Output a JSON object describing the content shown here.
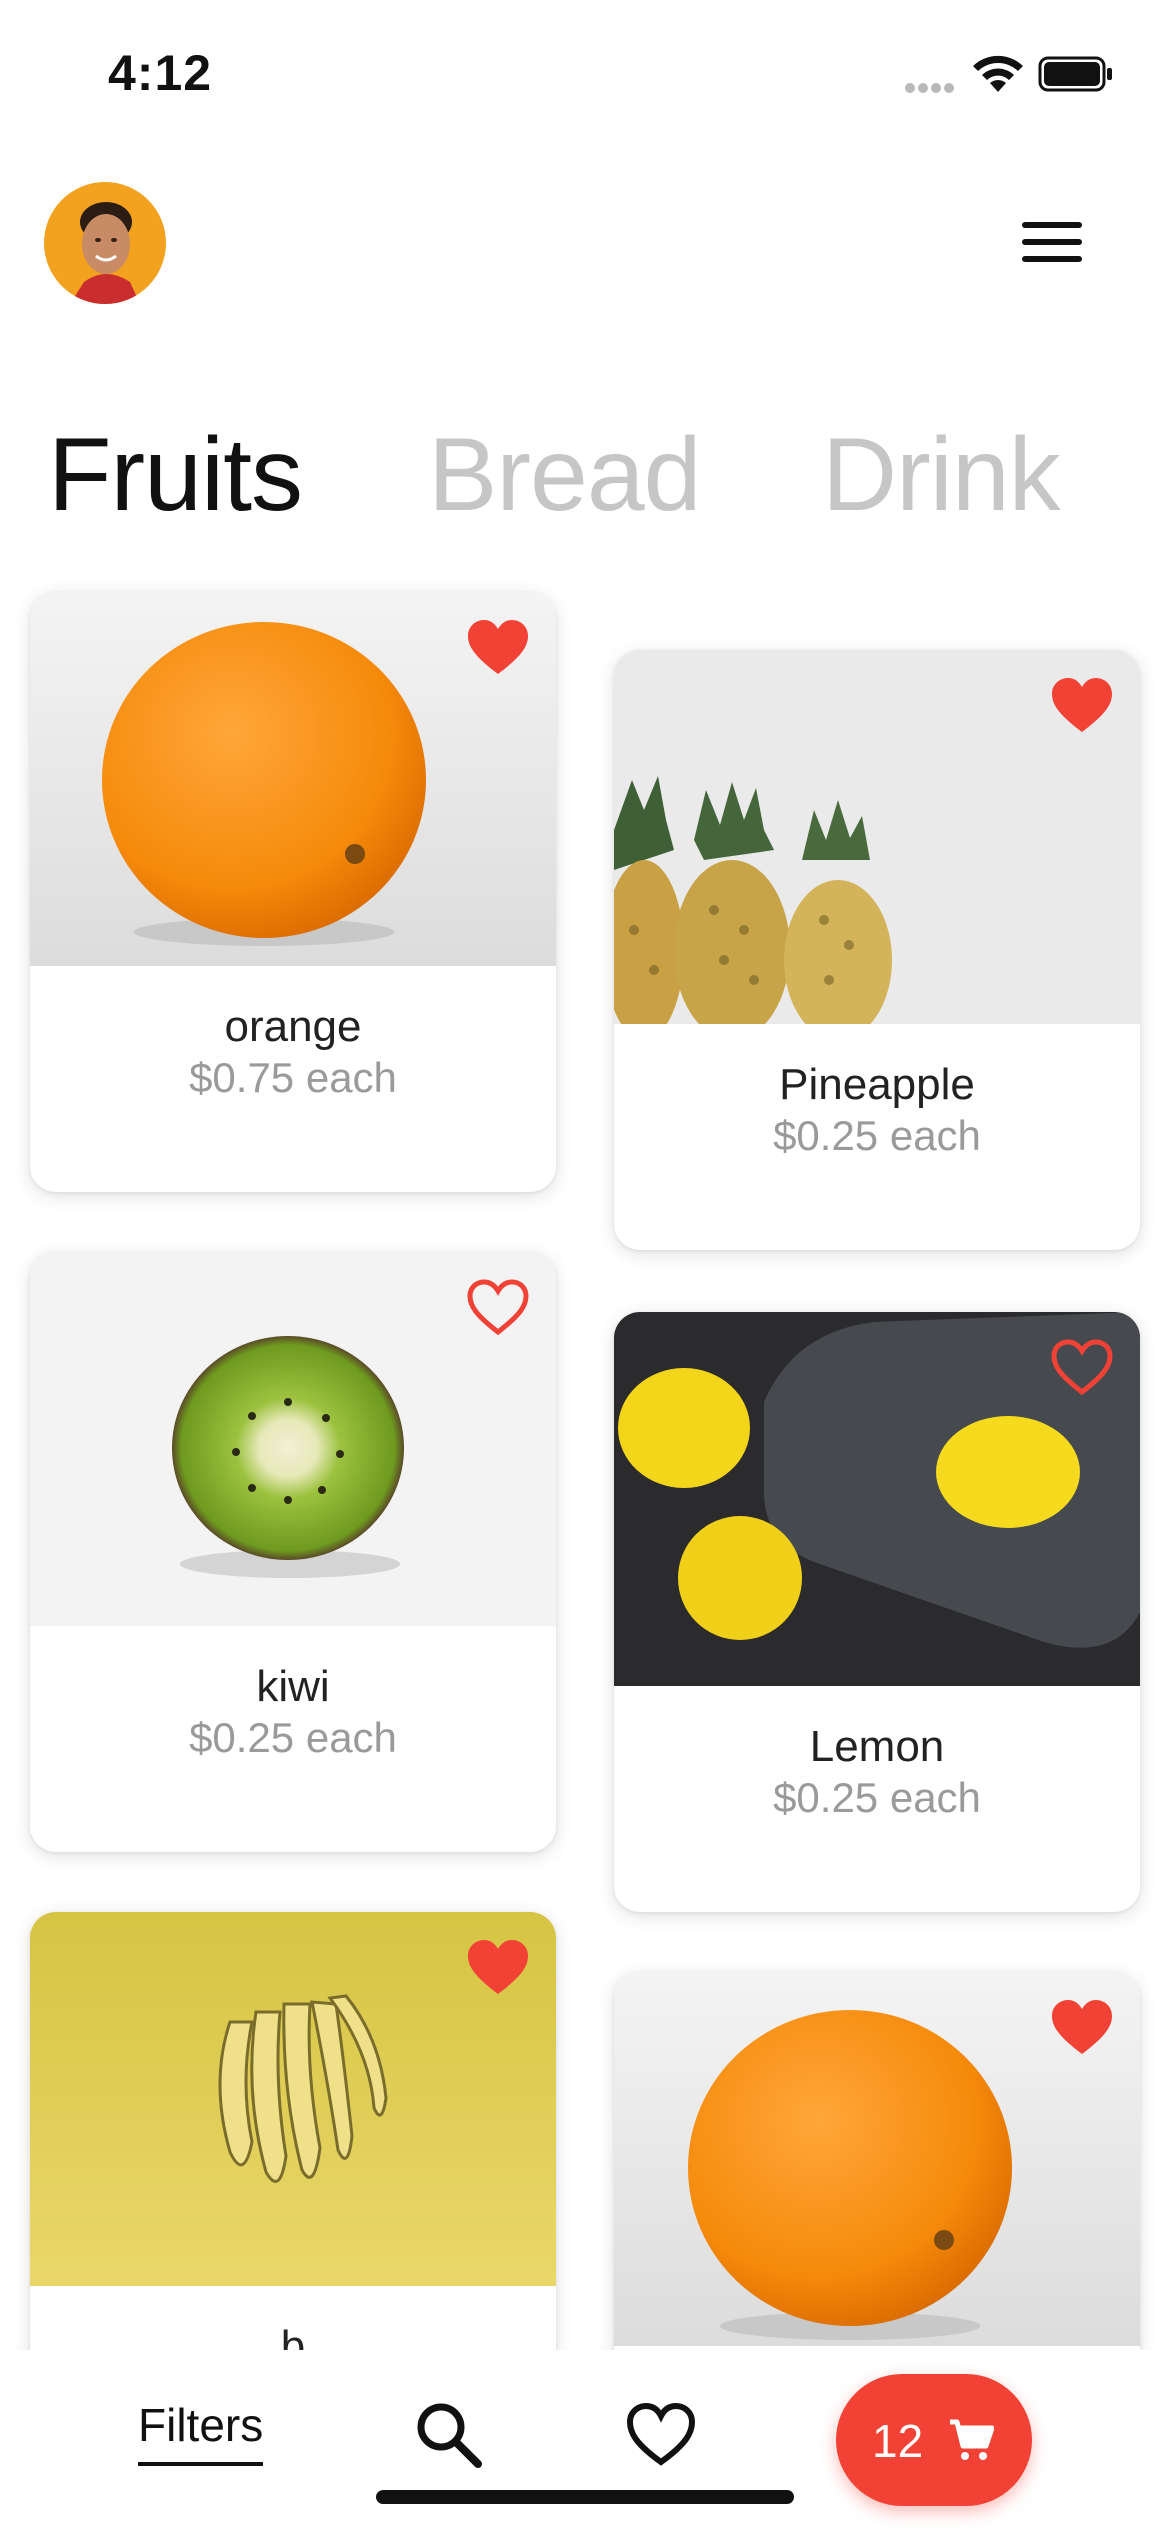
{
  "status_bar": {
    "time": "4:12"
  },
  "header": {
    "avatar": "user-avatar",
    "menu_icon": "hamburger-icon"
  },
  "tabs": [
    {
      "label": "Fruits",
      "active": true
    },
    {
      "label": "Bread",
      "active": false
    },
    {
      "label": "Drink",
      "active": false
    }
  ],
  "products": [
    {
      "name": "orange",
      "price": "$0.75 each",
      "favorite": true
    },
    {
      "name": "Pineapple",
      "price": "$0.25 each",
      "favorite": true
    },
    {
      "name": "kiwi",
      "price": "$0.25 each",
      "favorite": false
    },
    {
      "name": "Lemon",
      "price": "$0.25 each",
      "favorite": false
    },
    {
      "name": "b",
      "price": "",
      "favorite": true
    },
    {
      "name": "",
      "price": "",
      "favorite": true
    }
  ],
  "bottom_bar": {
    "filters_label": "Filters",
    "search_icon": "search-icon",
    "favorites_icon": "heart-icon",
    "cart_count": "12",
    "cart_icon": "cart-icon"
  },
  "colors": {
    "accent": "#f24236",
    "inactive_tab": "#c6c6c6",
    "price": "#9a9a9a"
  }
}
